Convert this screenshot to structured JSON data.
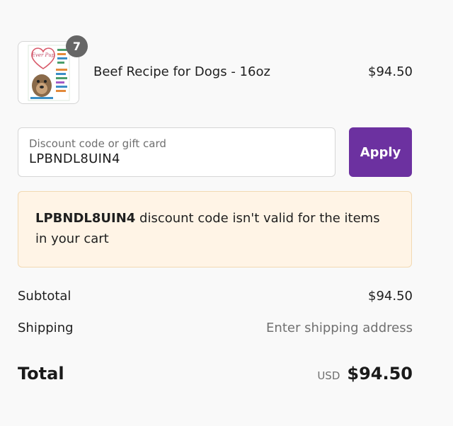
{
  "product": {
    "quantity": "7",
    "name": "Beef Recipe for Dogs - 16oz",
    "price": "$94.50",
    "image_text": "Ever Pup"
  },
  "discount": {
    "label": "Discount code or gift card",
    "value": "LPBNDL8UIN4",
    "apply_label": "Apply"
  },
  "error": {
    "code": "LPBNDL8UIN4",
    "message": " discount code isn't valid for the items in your cart"
  },
  "totals": {
    "subtotal_label": "Subtotal",
    "subtotal_value": "$94.50",
    "shipping_label": "Shipping",
    "shipping_value": "Enter shipping address",
    "total_label": "Total",
    "currency": "USD",
    "total_value": "$94.50"
  },
  "colors": {
    "accent": "#6c31a0",
    "error_background": "#fff4e6",
    "badge": "#666666"
  }
}
